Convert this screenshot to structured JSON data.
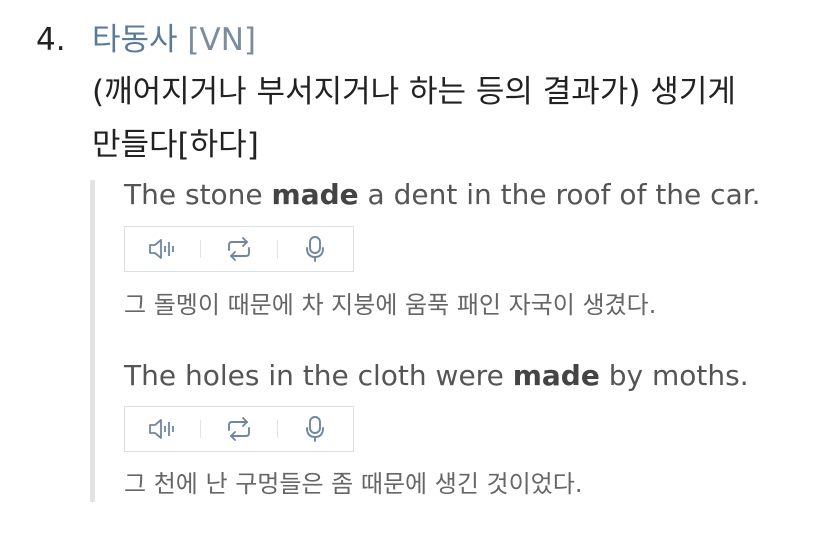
{
  "entry": {
    "number": "4.",
    "pos": "타동사",
    "pattern": "[VN]",
    "definition_line1": "(깨어지거나 부서지거나 하는 등의 결과가) 생기게",
    "definition_line2": "만들다[하다]"
  },
  "examples": [
    {
      "en_before": "The stone ",
      "en_bold": "made",
      "en_after": " a dent in the roof of the car.",
      "ko": "그 돌멩이 때문에 차 지붕에 움푹 패인 자국이 생겼다."
    },
    {
      "en_before": "The holes in the cloth were ",
      "en_bold": "made",
      "en_after": " by moths.",
      "ko": "그 천에 난 구멍들은 좀 때문에 생긴 것이었다."
    }
  ],
  "icons": [
    "speaker-icon",
    "repeat-icon",
    "microphone-icon"
  ],
  "colors": {
    "pos": "#5b7a99",
    "icon": "#6f86a3",
    "bar": "#e3e3e3",
    "border": "#d9dfe6"
  }
}
